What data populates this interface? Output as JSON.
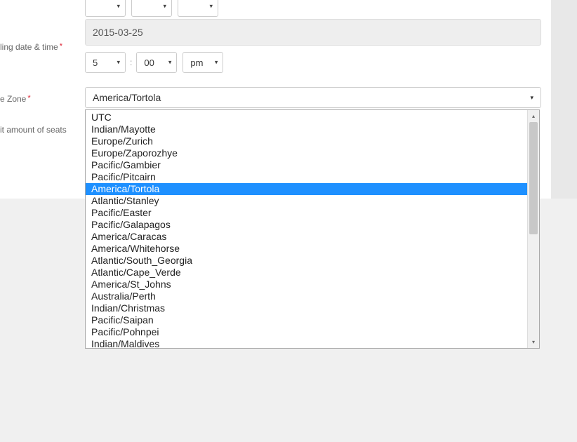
{
  "top_selects": {
    "a": "",
    "b": "",
    "c": ""
  },
  "date_value": "2015-03-25",
  "labels": {
    "ending": "ling date & time",
    "zone": "e Zone",
    "seats": "it amount of seats",
    "required": "*"
  },
  "time_selects": {
    "hour": "5",
    "minute": "00",
    "ampm": "pm"
  },
  "timezone_selected": "America/Tortola",
  "timezone_options": [
    "UTC",
    "Indian/Mayotte",
    "Europe/Zurich",
    "Europe/Zaporozhye",
    "Pacific/Gambier",
    "Pacific/Pitcairn",
    "America/Tortola",
    "Atlantic/Stanley",
    "Pacific/Easter",
    "Pacific/Galapagos",
    "America/Caracas",
    "America/Whitehorse",
    "Atlantic/South_Georgia",
    "Atlantic/Cape_Verde",
    "America/St_Johns",
    "Australia/Perth",
    "Indian/Christmas",
    "Pacific/Saipan",
    "Pacific/Pohnpei",
    "Indian/Maldives"
  ],
  "selected_index": 6
}
